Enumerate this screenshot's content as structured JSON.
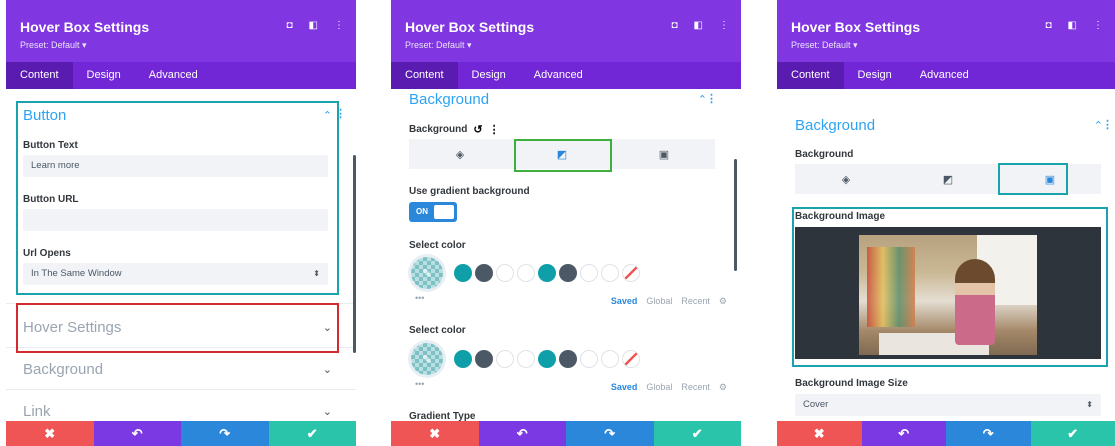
{
  "colors": {
    "header": "#8036e0",
    "tabs": "#7127d6",
    "accent": "#2ea3f2",
    "teal_highlight": "#1aa3ad",
    "red_highlight": "#d42a2f",
    "green_highlight": "#3caf3f",
    "cancel": "#ef5555",
    "undo": "#7b39e3",
    "redo": "#2b87da",
    "save": "#29c4a9"
  },
  "header": {
    "title": "Hover Box Settings",
    "preset": "Preset: Default ▾"
  },
  "tabs": [
    "Content",
    "Design",
    "Advanced"
  ],
  "panel1": {
    "button_section": "Button",
    "button_text_label": "Button Text",
    "button_text_value": "Learn more",
    "button_url_label": "Button URL",
    "button_url_value": "",
    "url_opens_label": "Url Opens",
    "url_opens_value": "In The Same Window",
    "hover_settings": "Hover Settings",
    "background": "Background",
    "link": "Link"
  },
  "panel2": {
    "section": "Background",
    "bg_label": "Background",
    "gradient_label": "Use gradient background",
    "toggle": "ON",
    "select_color": "Select color",
    "saved": "Saved",
    "global": "Global",
    "recent": "Recent",
    "gradient_type": "Gradient Type",
    "swatches": [
      "#0f9fa8",
      "#4c5866",
      "#ffffff",
      "#ffffff",
      "#0f9fa8",
      "#4c5866",
      "#ffffff",
      "#ffffff",
      "none"
    ]
  },
  "panel3": {
    "section": "Background",
    "bg_label": "Background",
    "image_label": "Background Image",
    "size_label": "Background Image Size",
    "size_value": "Cover"
  },
  "icons": {
    "cancel": "✖",
    "undo": "↶",
    "redo": "↷",
    "save": "✔"
  }
}
